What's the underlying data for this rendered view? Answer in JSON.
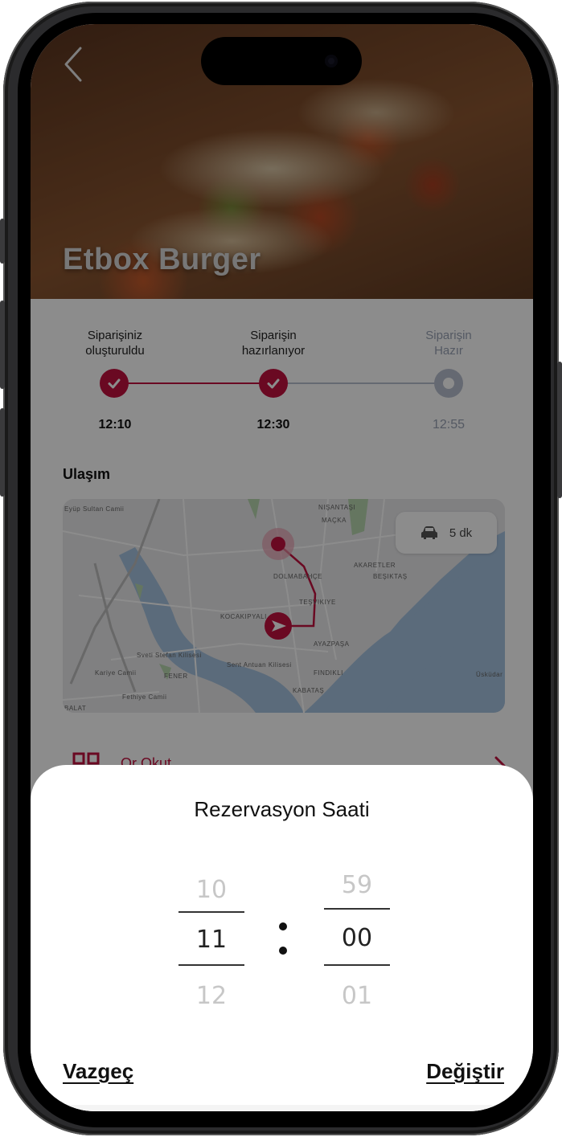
{
  "hero": {
    "restaurant_name": "Etbox Burger"
  },
  "order_status": {
    "steps": [
      {
        "label_line1": "Siparişiniz",
        "label_line2": "oluşturuldu",
        "time": "12:10",
        "state": "done"
      },
      {
        "label_line1": "Siparişin",
        "label_line2": "hazırlanıyor",
        "time": "12:30",
        "state": "done"
      },
      {
        "label_line1": "Siparişin",
        "label_line2": "Hazır",
        "time": "12:55",
        "state": "pending"
      }
    ]
  },
  "transport": {
    "title": "Ulaşım",
    "eta": "5 dk",
    "map_labels": [
      "NIŞANTAŞI",
      "MAÇKA",
      "AKARETLER",
      "BEŞIKTAŞ",
      "DOLMABAHÇE",
      "TEŞVIKIYE",
      "KOCAKIPYALI",
      "AYAZPAŞA",
      "FINDIKLI",
      "KABATAŞ",
      "Sent Antuan Kilisesi",
      "Sveti Stefan Kilisesi",
      "Eyüp Sultan Camii",
      "Üsküdar",
      "FENER",
      "Kariye Camii",
      "Fethiye Camii",
      "BALAT"
    ]
  },
  "qr": {
    "label": "Qr Okut"
  },
  "sheet": {
    "title": "Rezervasyon Saati",
    "hours": {
      "prev": "10",
      "selected": "11",
      "next": "12"
    },
    "minutes": {
      "prev": "59",
      "selected": "00",
      "next": "01"
    },
    "cancel_label": "Vazgeç",
    "confirm_label": "Değiştir"
  },
  "colors": {
    "accent": "#c2123f",
    "pending": "#b9bfcf"
  }
}
